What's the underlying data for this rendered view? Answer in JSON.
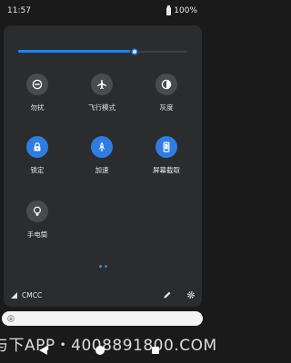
{
  "status_bar": {
    "time": "11:57",
    "battery": "100%"
  },
  "brightness": {
    "level": 0.69,
    "accent": "#2f7de0"
  },
  "tiles": [
    {
      "label": "勿扰",
      "icon": "do-not-disturb-icon",
      "active": false
    },
    {
      "label": "飞行模式",
      "icon": "airplane-icon",
      "active": false
    },
    {
      "label": "灰度",
      "icon": "grayscale-icon",
      "active": false
    },
    {
      "label": "锁定",
      "icon": "lock-icon",
      "active": true
    },
    {
      "label": "加速",
      "icon": "rocket-icon",
      "active": true
    },
    {
      "label": "屏幕截取",
      "icon": "screenshot-icon",
      "active": true
    },
    {
      "label": "手电筒",
      "icon": "flashlight-icon",
      "active": false
    }
  ],
  "pager": {
    "pages": 2,
    "current": 2
  },
  "footer": {
    "carrier": "CMCC"
  },
  "watermark": "与下APP・4008891800.COM"
}
